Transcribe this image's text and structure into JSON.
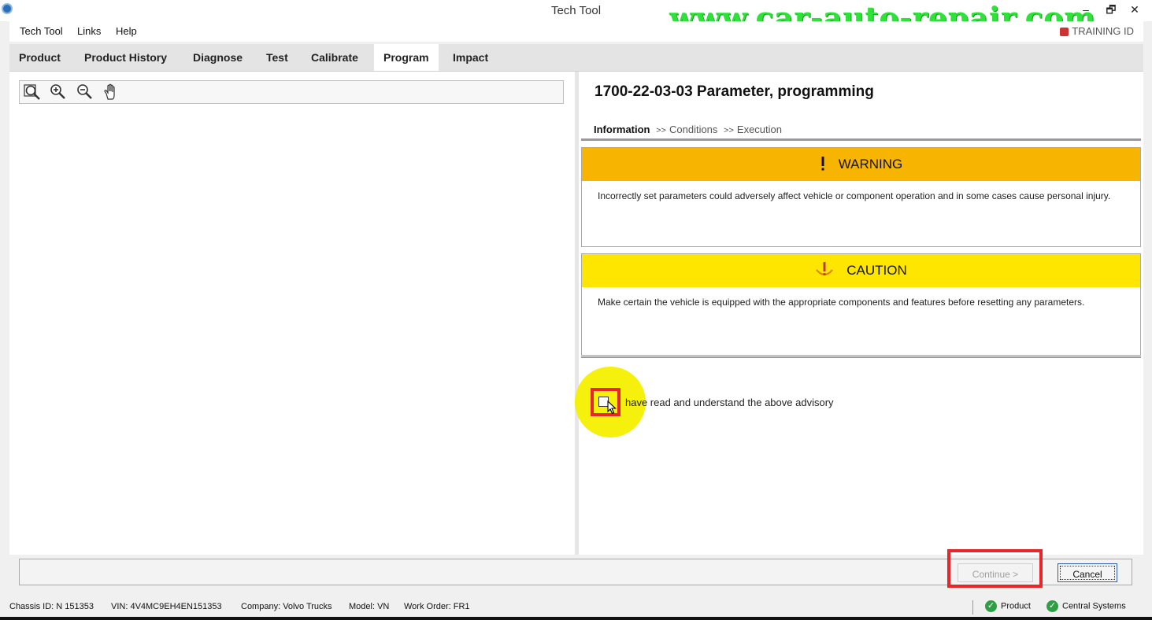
{
  "window": {
    "title": "Tech Tool",
    "watermark": "www.car-auto-repair.com",
    "minimize": "–",
    "restore": "🗗",
    "close": "✕"
  },
  "menu": {
    "items": [
      "Tech Tool",
      "Links",
      "Help"
    ],
    "training_label": "TRAINING ID"
  },
  "tabs": {
    "items": [
      "Product",
      "Product History",
      "Diagnose",
      "Test",
      "Calibrate",
      "Program",
      "Impact"
    ],
    "active": "Program"
  },
  "toolbar": {
    "icons": [
      "zoom-fit-icon",
      "zoom-in-icon",
      "zoom-out-icon",
      "pan-hand-icon"
    ]
  },
  "procedure": {
    "title": "1700-22-03-03 Parameter, programming",
    "breadcrumb": {
      "current": "Information",
      "sep": ">>",
      "steps": [
        "Conditions",
        "Execution"
      ]
    },
    "warning": {
      "heading": "WARNING",
      "text": "Incorrectly set parameters could adversely affect vehicle or component operation and in some cases cause personal injury."
    },
    "caution": {
      "heading": "CAUTION",
      "text": "Make certain the vehicle is equipped with the appropriate components and features before resetting any parameters."
    },
    "acknowledge_label": "have read and understand the above advisory"
  },
  "buttons": {
    "continue": "Continue >",
    "cancel": "Cancel"
  },
  "status": {
    "chassis": "Chassis ID: N 151353",
    "vin": "VIN: 4V4MC9EH4EN151353",
    "company": "Company: Volvo Trucks",
    "model": "Model: VN",
    "work_order": "Work Order: FR1",
    "product": "Product",
    "central": "Central Systems"
  },
  "colors": {
    "warning": "#f7b400",
    "caution": "#ffe600",
    "highlight_frame": "#e8262a",
    "ok_green": "#2ea043"
  }
}
